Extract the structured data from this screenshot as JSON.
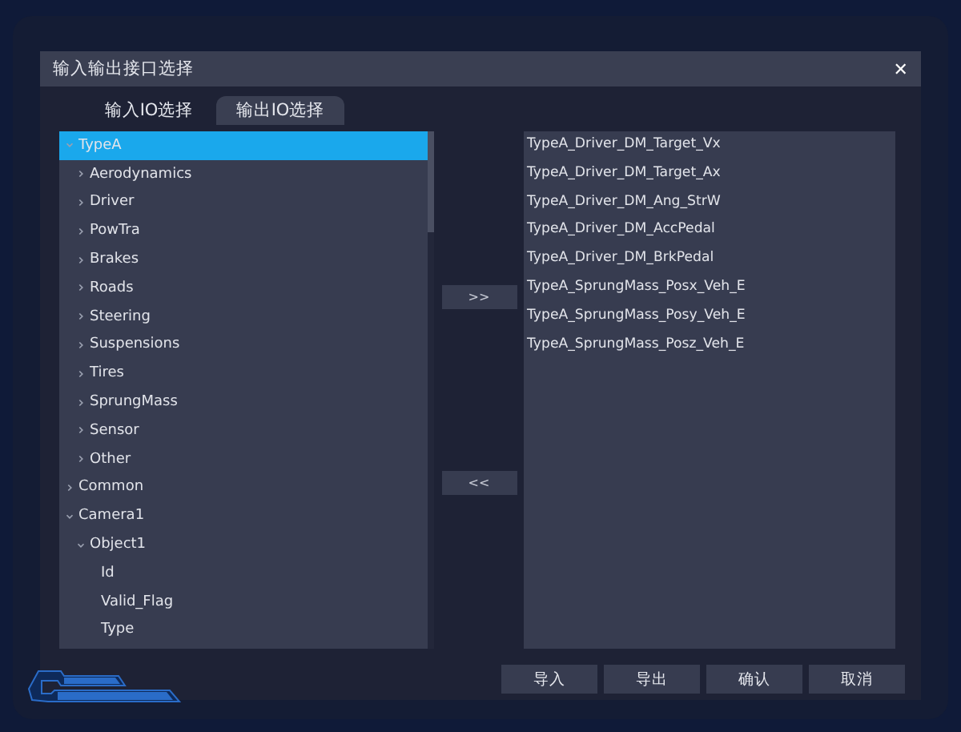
{
  "window": {
    "title": "输入输出接口选择",
    "close": "✕"
  },
  "tabs": [
    {
      "label": "输入IO选择",
      "selected": false
    },
    {
      "label": "输出IO选择",
      "selected": true
    }
  ],
  "tree": [
    {
      "label": "TypeA",
      "expanded": true,
      "selected": true,
      "children": [
        {
          "label": "Aerodynamics",
          "expanded": false,
          "selected": false
        },
        {
          "label": "Driver",
          "expanded": false,
          "selected": false
        },
        {
          "label": "PowTra",
          "expanded": false,
          "selected": false
        },
        {
          "label": "Brakes",
          "expanded": false,
          "selected": false
        },
        {
          "label": "Roads",
          "expanded": false,
          "selected": false
        },
        {
          "label": "Steering",
          "expanded": false,
          "selected": false
        },
        {
          "label": "Suspensions",
          "expanded": false,
          "selected": false
        },
        {
          "label": "Tires",
          "expanded": false,
          "selected": false
        },
        {
          "label": "SprungMass",
          "expanded": false,
          "selected": false
        },
        {
          "label": "Sensor",
          "expanded": false,
          "selected": false
        },
        {
          "label": "Other",
          "expanded": false,
          "selected": false
        }
      ]
    },
    {
      "label": "Common",
      "expanded": false,
      "selected": false
    },
    {
      "label": "Camera1",
      "expanded": true,
      "selected": false,
      "children": [
        {
          "label": "Object1",
          "expanded": true,
          "selected": false,
          "children": [
            {
              "label": "Id",
              "selected": false
            },
            {
              "label": "Valid_Flag",
              "selected": false
            },
            {
              "label": "Type",
              "selected": false
            }
          ]
        }
      ]
    }
  ],
  "move_buttons": [
    ">>",
    "<<"
  ],
  "selected_signals": [
    "TypeA_Driver_DM_Target_Vx",
    "TypeA_Driver_DM_Target_Ax",
    "TypeA_Driver_DM_Ang_StrW",
    "TypeA_Driver_DM_AccPedal",
    "TypeA_Driver_DM_BrkPedal",
    "TypeA_SprungMass_Posx_Veh_E",
    "TypeA_SprungMass_Posy_Veh_E",
    "TypeA_SprungMass_Posz_Veh_E"
  ],
  "buttons": [
    "导入",
    "导出",
    "确认",
    "取消"
  ]
}
